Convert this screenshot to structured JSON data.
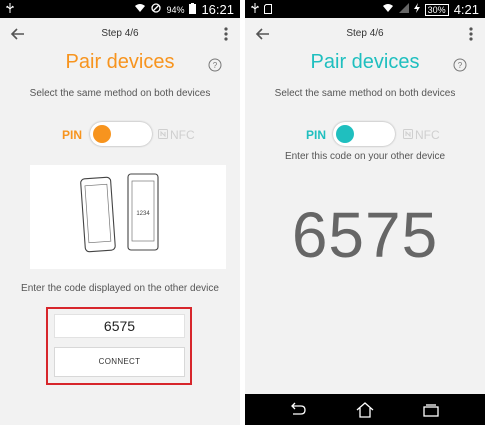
{
  "colors": {
    "left_accent": "#f7941e",
    "right_accent": "#1fbfbf",
    "highlight_border": "#d7262b",
    "nfc_inactive": "#cfcfcf"
  },
  "left": {
    "statusbar": {
      "battery_pct": "94%",
      "time": "16:21",
      "icons": [
        "usb-icon",
        "wifi-icon",
        "blocked-icon",
        "battery-icon"
      ]
    },
    "step": "Step 4/6",
    "title": "Pair devices",
    "instruction": "Select the same method on both devices",
    "mode": {
      "pin_label": "PIN",
      "nfc_label": "NFC",
      "selected": "PIN"
    },
    "illustration": {
      "phone_code": "1234"
    },
    "enter_label": "Enter the code displayed on the other device",
    "code_input_value": "6575",
    "connect_label": "CONNECT"
  },
  "right": {
    "statusbar": {
      "battery_pct": "30%",
      "time": "4:21",
      "icons": [
        "usb-icon",
        "sd-icon",
        "wifi-icon",
        "signal-icon",
        "bolt-icon",
        "battery-icon"
      ]
    },
    "step": "Step 4/6",
    "title": "Pair devices",
    "instruction": "Select the same method on both devices",
    "mode": {
      "pin_label": "PIN",
      "nfc_label": "NFC",
      "selected": "PIN"
    },
    "code_subtitle": "Enter this code on your other device",
    "code": "6575",
    "navbar": [
      "back-nav-icon",
      "home-nav-icon",
      "recents-nav-icon"
    ]
  }
}
